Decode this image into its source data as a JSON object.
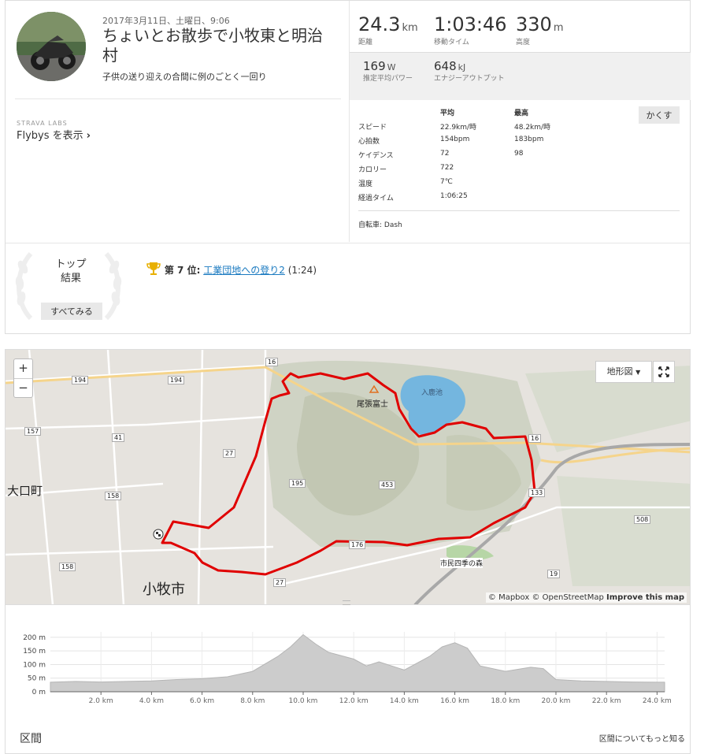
{
  "activity": {
    "date": "2017年3月11日、土曜日、9:06",
    "title": "ちょいとお散歩で小牧東と明治村",
    "description": "子供の送り迎えの合間に例のごとく一回り",
    "labs_label": "STRAVA LABS",
    "flybys_label": "Flybys を表示"
  },
  "stats": {
    "distance": {
      "value": "24.3",
      "unit": "km",
      "label": "距離"
    },
    "moving_time": {
      "value": "1:03:46",
      "label": "移動タイム"
    },
    "elevation": {
      "value": "330",
      "unit": "m",
      "label": "高度"
    },
    "power": {
      "value": "169",
      "unit": "W",
      "label": "推定平均パワー"
    },
    "energy": {
      "value": "648",
      "unit": "kJ",
      "label": "エナジーアウトプット"
    }
  },
  "metrics": {
    "hide_label": "かくす",
    "col_avg": "平均",
    "col_max": "最高",
    "rows": [
      {
        "label": "スピード",
        "avg": "22.9km/時",
        "max": "48.2km/時"
      },
      {
        "label": "心拍数",
        "avg": "154bpm",
        "max": "183bpm"
      },
      {
        "label": "ケイデンス",
        "avg": "72",
        "max": "98"
      },
      {
        "label": "カロリー",
        "avg": "722",
        "max": ""
      },
      {
        "label": "温度",
        "avg": "7℃",
        "max": ""
      },
      {
        "label": "経過タイム",
        "avg": "1:06:25",
        "max": ""
      }
    ],
    "bike_label": "自転車:",
    "bike_value": "Dash"
  },
  "achievements": {
    "heading_line1": "トップ",
    "heading_line2": "結果",
    "see_all": "すべてみる",
    "rank_prefix": "第",
    "rank": "7",
    "rank_suffix": "位:",
    "segment_name": "工業団地への登り2",
    "segment_time": "(1:24)"
  },
  "map": {
    "zoom_in": "+",
    "zoom_out": "−",
    "layer_button": "地形図",
    "attribution_mapbox": "© Mapbox",
    "attribution_osm": "© OpenStreetMap",
    "attribution_improve": "Improve this map",
    "labels": {
      "city": "小牧市",
      "town": "大口町",
      "mountain": "尾張富士",
      "lake": "入鹿池",
      "forest": "市民四季の森",
      "route_194a": "194",
      "route_194b": "194",
      "route_16a": "16",
      "route_16b": "16",
      "route_157": "157",
      "route_41": "41",
      "route_27a": "27",
      "route_27b": "27",
      "route_158a": "158",
      "route_158b": "158",
      "route_195": "195",
      "route_453": "453",
      "route_19": "19",
      "route_508": "508",
      "route_133": "133",
      "route_176": "176"
    }
  },
  "elevation_chart": {
    "chart_data": {
      "type": "area",
      "x": [
        0,
        1,
        2,
        3,
        4,
        5,
        6,
        7,
        8,
        9,
        9.5,
        10,
        10.5,
        11,
        12,
        12.5,
        13,
        14,
        15,
        15.5,
        16,
        16.5,
        17,
        18,
        19,
        19.5,
        20,
        21,
        22,
        23,
        24,
        24.3
      ],
      "y": [
        35,
        38,
        36,
        38,
        40,
        45,
        48,
        55,
        75,
        130,
        165,
        210,
        175,
        145,
        120,
        95,
        110,
        80,
        130,
        165,
        180,
        160,
        95,
        75,
        90,
        85,
        45,
        40,
        38,
        36,
        35,
        35
      ],
      "xticks": [
        "2.0 km",
        "4.0 km",
        "6.0 km",
        "8.0 km",
        "10.0 km",
        "12.0 km",
        "14.0 km",
        "16.0 km",
        "18.0 km",
        "20.0 km",
        "22.0 km",
        "24.0 km"
      ],
      "yticks": [
        "0 m",
        "50 m",
        "100 m",
        "150 m",
        "200 m"
      ],
      "xlim": [
        0,
        24.3
      ],
      "ylim": [
        0,
        220
      ]
    }
  },
  "segments": {
    "title": "区間",
    "learn_more": "区間についてもっと知る"
  }
}
